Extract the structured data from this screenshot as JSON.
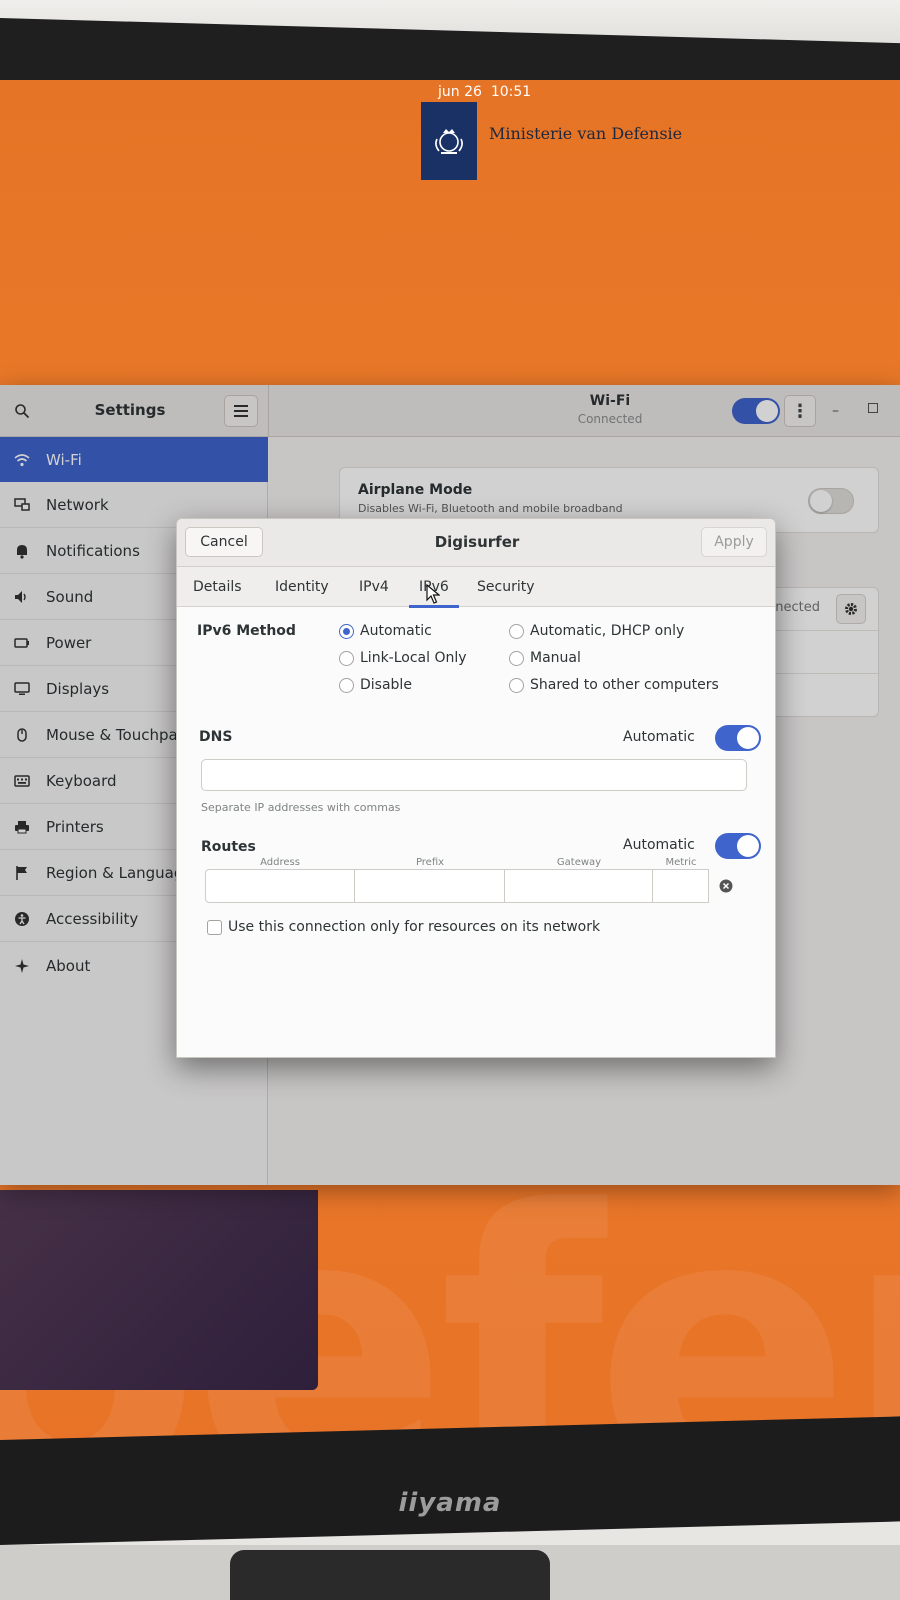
{
  "topbar": {
    "date": "jun 26",
    "time": "10:51",
    "org_name": "Ministerie van Defensie"
  },
  "settings": {
    "title": "Settings",
    "panel_title": "Wi-Fi",
    "panel_subtitle": "Connected",
    "wifi_enabled": true,
    "sidebar": [
      {
        "label": "Wi-Fi",
        "icon": "wifi-icon",
        "active": true
      },
      {
        "label": "Network",
        "icon": "network-icon"
      },
      {
        "label": "Notifications",
        "icon": "bell-icon"
      },
      {
        "label": "Sound",
        "icon": "speaker-icon"
      },
      {
        "label": "Power",
        "icon": "power-icon"
      },
      {
        "label": "Displays",
        "icon": "display-icon"
      },
      {
        "label": "Mouse & Touchpad",
        "icon": "mouse-icon"
      },
      {
        "label": "Keyboard",
        "icon": "keyboard-icon"
      },
      {
        "label": "Printers",
        "icon": "printer-icon"
      },
      {
        "label": "Region & Language",
        "icon": "flag-icon"
      },
      {
        "label": "Accessibility",
        "icon": "accessibility-icon"
      },
      {
        "label": "About",
        "icon": "star-icon"
      }
    ],
    "airplane": {
      "title": "Airplane Mode",
      "subtitle": "Disables Wi-Fi, Bluetooth and mobile broadband",
      "enabled": false
    },
    "network_status": "Connected"
  },
  "dialog": {
    "title": "Digisurfer",
    "cancel_label": "Cancel",
    "apply_label": "Apply",
    "tabs": [
      "Details",
      "Identity",
      "IPv4",
      "IPv6",
      "Security"
    ],
    "active_tab": "IPv6",
    "ipv6_method_label": "IPv6 Method",
    "methods": [
      "Automatic",
      "Automatic, DHCP only",
      "Link-Local Only",
      "Manual",
      "Disable",
      "Shared to other computers"
    ],
    "selected_method": "Automatic",
    "dns": {
      "label": "DNS",
      "automatic_label": "Automatic",
      "automatic": true,
      "value": "",
      "hint": "Separate IP addresses with commas"
    },
    "routes": {
      "label": "Routes",
      "automatic_label": "Automatic",
      "automatic": true,
      "columns": [
        "Address",
        "Prefix",
        "Gateway",
        "Metric"
      ]
    },
    "only_local_label": "Use this connection only for resources on its network",
    "only_local": false
  },
  "monitor": {
    "brand": "iiyama"
  },
  "colors": {
    "accent": "#3f64cc",
    "wallpaper": "#e87328",
    "logo_blue": "#1a3166"
  }
}
